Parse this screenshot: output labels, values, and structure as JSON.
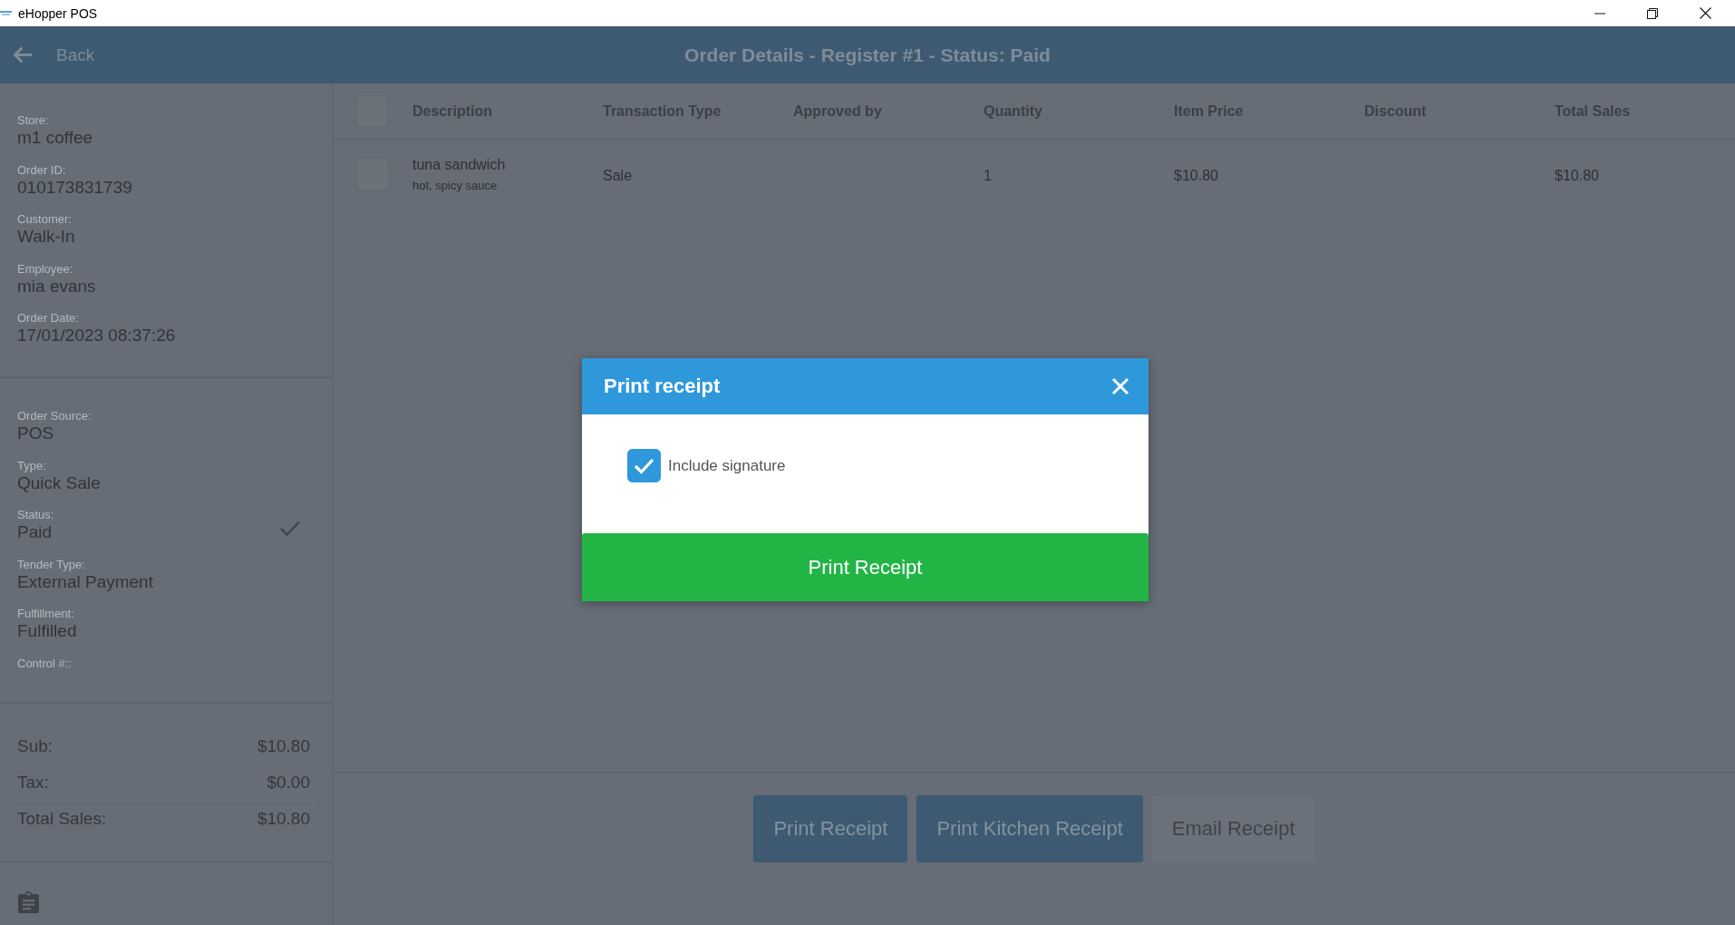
{
  "window": {
    "title": "eHopper POS"
  },
  "header": {
    "back": "Back",
    "title": "Order Details - Register #1 - Status: Paid"
  },
  "order_info": [
    {
      "label": "Store:",
      "value": "m1 coffee"
    },
    {
      "label": "Order ID:",
      "value": "010173831739"
    },
    {
      "label": "Customer:",
      "value": "Walk-In"
    },
    {
      "label": "Employee:",
      "value": "mia evans"
    },
    {
      "label": "Order Date:",
      "value": "17/01/2023 08:37:26"
    }
  ],
  "order_details": [
    {
      "label": "Order Source:",
      "value": "POS",
      "checked": false
    },
    {
      "label": "Type:",
      "value": "Quick Sale",
      "checked": false
    },
    {
      "label": "Status:",
      "value": "Paid",
      "checked": true
    },
    {
      "label": "Tender Type:",
      "value": "External Payment",
      "checked": false
    },
    {
      "label": "Fulfillment:",
      "value": "Fulfilled",
      "checked": false
    },
    {
      "label": "Control #::",
      "checked": false
    }
  ],
  "totals": [
    {
      "label": "Sub:",
      "amount": "$10.80"
    },
    {
      "label": "Tax:",
      "amount": "$0.00"
    },
    {
      "label": "Total Sales:",
      "amount": "$10.80"
    }
  ],
  "table": {
    "all_checked": false,
    "columns": [
      "Description",
      "Transaction Type",
      "Approved by",
      "Quantity",
      "Item Price",
      "Discount",
      "Total Sales"
    ],
    "rows": [
      {
        "selected": false,
        "description": "tuna sandwich",
        "modifiers": "hot, spicy sauce",
        "transaction_type": "Sale",
        "quantity": "1",
        "item_price": "$10.80",
        "total_sales": "$10.80"
      }
    ]
  },
  "actions": [
    {
      "label": "Print Receipt",
      "kind": "primary"
    },
    {
      "label": "Print Kitchen Receipt",
      "kind": "primary"
    },
    {
      "label": "Email Receipt",
      "kind": "secondary"
    }
  ],
  "dialog": {
    "title": "Print receipt",
    "option": {
      "label": "Include signature",
      "checked": true
    },
    "button": "Print Receipt"
  }
}
